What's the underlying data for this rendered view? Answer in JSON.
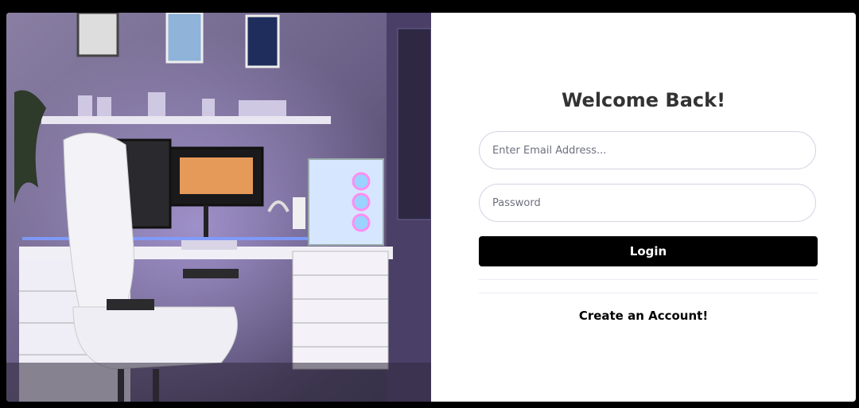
{
  "login": {
    "title": "Welcome Back!",
    "email_placeholder": "Enter Email Address...",
    "password_placeholder": "Password",
    "login_label": "Login",
    "create_account_label": "Create an Account!"
  },
  "colors": {
    "page_background": "#000000",
    "card_background": "#ffffff",
    "button_background": "#000000",
    "field_border": "#d1d3e2",
    "photo_wall": "#6a5f86",
    "led_glow": "#7d9cff"
  },
  "icons": [
    "gaming-setup-photo"
  ]
}
